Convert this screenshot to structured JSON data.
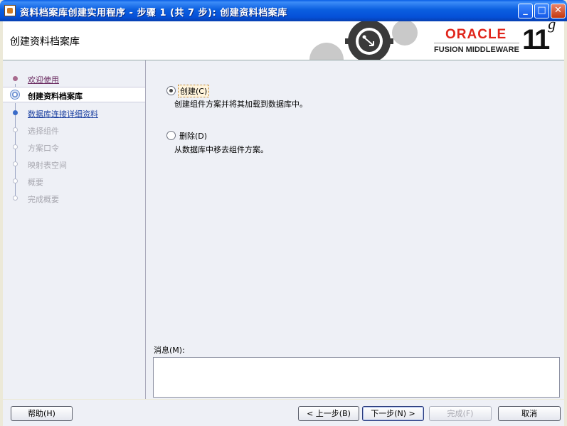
{
  "window": {
    "title": "资料档案库创建实用程序 - 步骤 1 (共 7 步): 创建资料档案库",
    "minimize": "_",
    "maximize": "□",
    "close": "✕"
  },
  "header": {
    "heading": "创建资料档案库",
    "brand": "ORACLE",
    "product": "FUSION MIDDLEWARE",
    "version_number": "11",
    "version_suffix": "g"
  },
  "nav": {
    "items": [
      {
        "label": "欢迎使用",
        "state": "done"
      },
      {
        "label": "创建资料档案库",
        "state": "current"
      },
      {
        "label": "数据库连接详细资料",
        "state": "link"
      },
      {
        "label": "选择组件",
        "state": "disabled"
      },
      {
        "label": "方案口令",
        "state": "disabled"
      },
      {
        "label": "映射表空间",
        "state": "disabled"
      },
      {
        "label": "概要",
        "state": "disabled"
      },
      {
        "label": "完成概要",
        "state": "disabled"
      }
    ]
  },
  "options": {
    "create": {
      "label": "创建(C)",
      "description": "创建组件方案并将其加载到数据库中。",
      "selected": true
    },
    "drop": {
      "label": "删除(D)",
      "description": "从数据库中移去组件方案。",
      "selected": false
    }
  },
  "messages": {
    "label": "消息(M):",
    "value": ""
  },
  "footer": {
    "help": "帮助(H)",
    "back": "< 上一步(B)",
    "next": "下一步(N) >",
    "finish": "完成(F)",
    "cancel": "取消"
  }
}
